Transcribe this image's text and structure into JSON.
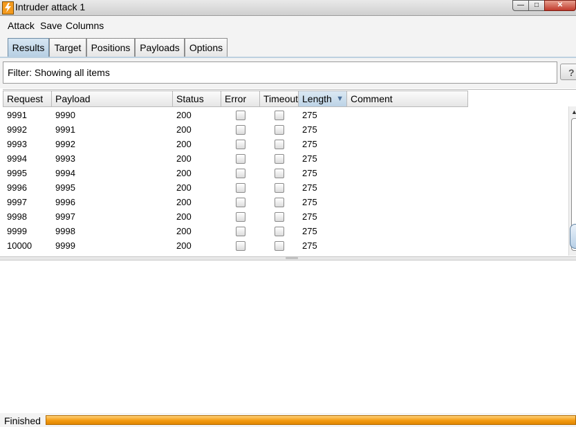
{
  "window": {
    "title": "Intruder attack 1",
    "controls": {
      "minimize": "—",
      "maximize": "□",
      "close": "✕"
    }
  },
  "menu": {
    "attack": "Attack",
    "save": "Save",
    "columns": "Columns"
  },
  "tabs": [
    {
      "label": "Results",
      "active": true
    },
    {
      "label": "Target"
    },
    {
      "label": "Positions"
    },
    {
      "label": "Payloads"
    },
    {
      "label": "Options"
    }
  ],
  "filter": {
    "text": "Filter: Showing all items",
    "help": "?"
  },
  "table": {
    "columns": [
      "Request",
      "Payload",
      "Status",
      "Error",
      "Timeout",
      "Length",
      "Comment"
    ],
    "sorted_column": "Length",
    "sort_direction": "descending",
    "rows": [
      {
        "request": "9991",
        "payload": "9990",
        "status": "200",
        "error": false,
        "timeout": false,
        "length": "275",
        "comment": ""
      },
      {
        "request": "9992",
        "payload": "9991",
        "status": "200",
        "error": false,
        "timeout": false,
        "length": "275",
        "comment": ""
      },
      {
        "request": "9993",
        "payload": "9992",
        "status": "200",
        "error": false,
        "timeout": false,
        "length": "275",
        "comment": ""
      },
      {
        "request": "9994",
        "payload": "9993",
        "status": "200",
        "error": false,
        "timeout": false,
        "length": "275",
        "comment": ""
      },
      {
        "request": "9995",
        "payload": "9994",
        "status": "200",
        "error": false,
        "timeout": false,
        "length": "275",
        "comment": ""
      },
      {
        "request": "9996",
        "payload": "9995",
        "status": "200",
        "error": false,
        "timeout": false,
        "length": "275",
        "comment": ""
      },
      {
        "request": "9997",
        "payload": "9996",
        "status": "200",
        "error": false,
        "timeout": false,
        "length": "275",
        "comment": ""
      },
      {
        "request": "9998",
        "payload": "9997",
        "status": "200",
        "error": false,
        "timeout": false,
        "length": "275",
        "comment": ""
      },
      {
        "request": "9999",
        "payload": "9998",
        "status": "200",
        "error": false,
        "timeout": false,
        "length": "275",
        "comment": ""
      },
      {
        "request": "10000",
        "payload": "9999",
        "status": "200",
        "error": false,
        "timeout": false,
        "length": "275",
        "comment": ""
      }
    ]
  },
  "status": {
    "label": "Finished",
    "progress": 1.0
  },
  "colors": {
    "progress": "#f39a10",
    "active_tab": "#b7cfe3",
    "accent": "#4a6f99"
  },
  "icons": {
    "app": "burp-lightning-icon",
    "sort": "sort-descending-icon",
    "scroll_up": "arrow-up-icon"
  }
}
